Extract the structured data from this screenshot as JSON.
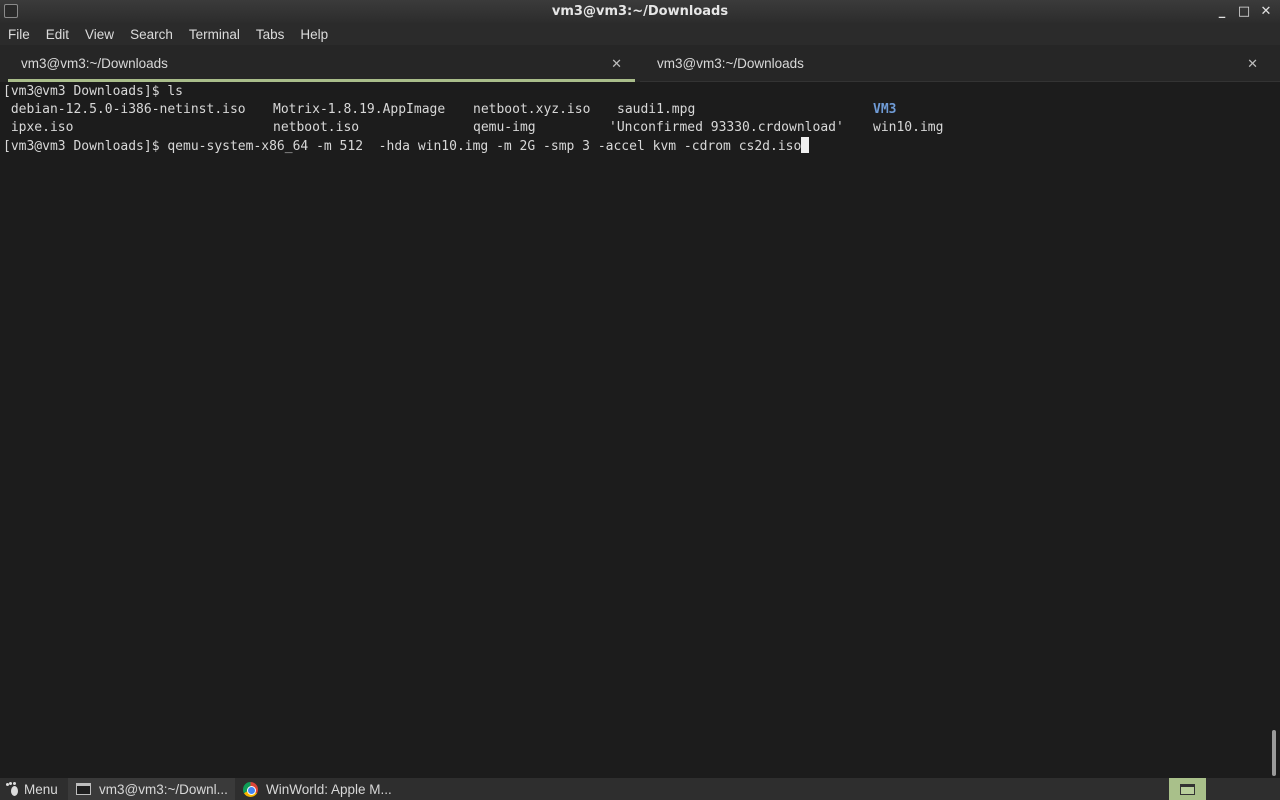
{
  "window": {
    "title": "vm3@vm3:~/Downloads",
    "controls": {
      "minimize": "_",
      "maximize": "□",
      "close": "✕"
    }
  },
  "menubar": {
    "items": [
      "File",
      "Edit",
      "View",
      "Search",
      "Terminal",
      "Tabs",
      "Help"
    ]
  },
  "tabs": [
    {
      "label": "vm3@vm3:~/Downloads",
      "active": true,
      "close": "✕"
    },
    {
      "label": "vm3@vm3:~/Downloads",
      "active": false,
      "close": "✕"
    }
  ],
  "terminal": {
    "prompt1": "[vm3@vm3 Downloads]$ ls",
    "ls_rows": [
      [
        " debian-12.5.0-i386-netinst.iso",
        "Motrix-1.8.19.AppImage",
        "netboot.xyz.iso",
        "saudi1.mpg",
        "VM3"
      ],
      [
        " ipxe.iso",
        "netboot.iso",
        "qemu-img",
        "'Unconfirmed 93330.crdownload'",
        "win10.img"
      ]
    ],
    "directory_entry": "VM3",
    "prompt2": "[vm3@vm3 Downloads]$ qemu-system-x86_64 -m 512  -hda win10.img -m 2G -smp 3 -accel kvm -cdrom cs2d.iso"
  },
  "taskbar": {
    "menu_label": "Menu",
    "tasks": [
      {
        "label": "vm3@vm3:~/Downl...",
        "icon": "terminal-icon",
        "active": true
      },
      {
        "label": "WinWorld: Apple M...",
        "icon": "chrome-icon",
        "active": false
      }
    ]
  },
  "colors": {
    "accent": "#a9bd8a",
    "directory": "#6f9bd6",
    "background": "#1c1c1c"
  }
}
